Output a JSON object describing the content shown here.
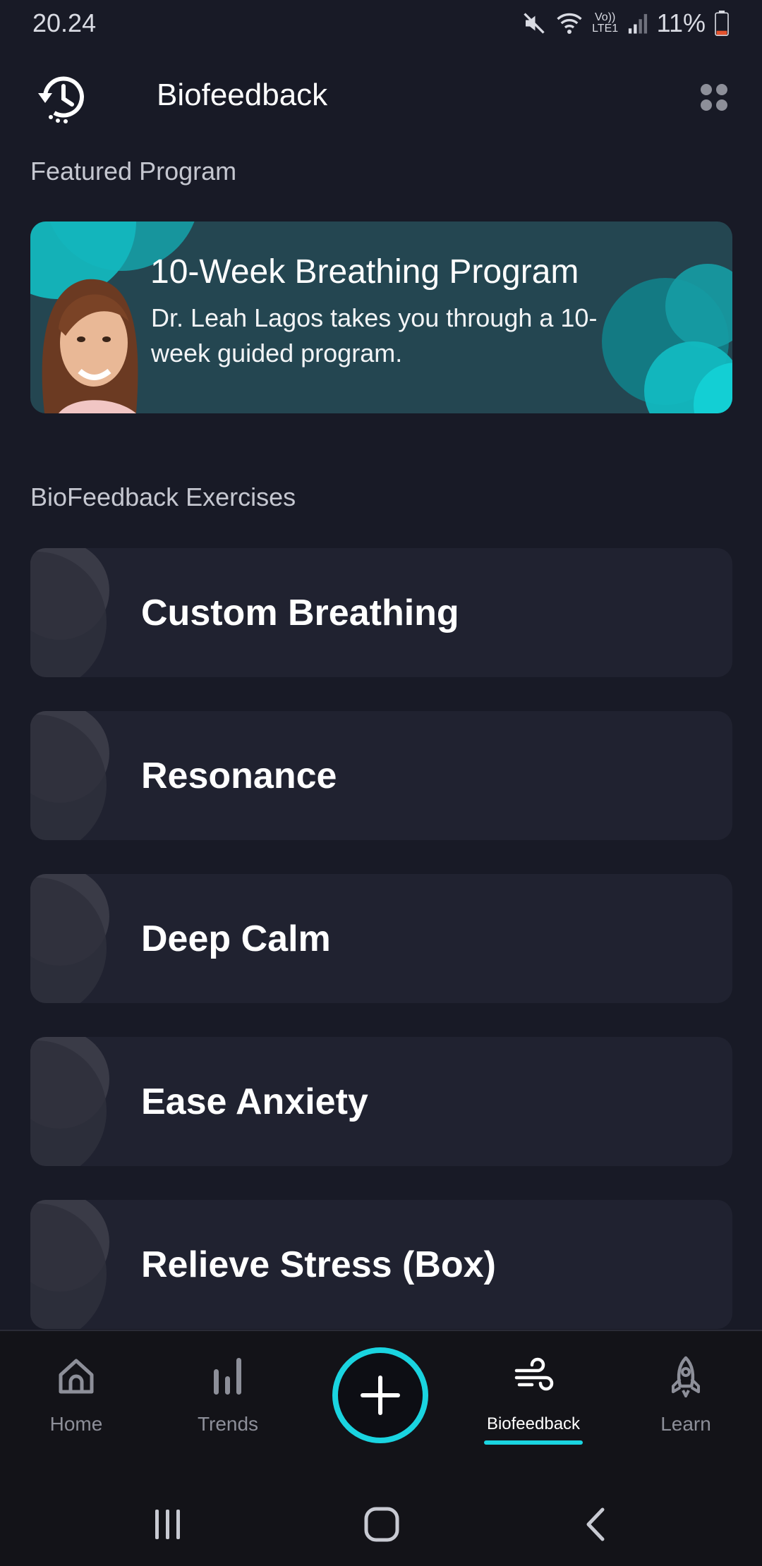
{
  "status_bar": {
    "time": "20.24",
    "battery": "11%",
    "network_label": "Vo)) LTE1"
  },
  "app_bar": {
    "title": "Biofeedback"
  },
  "featured": {
    "section_label": "Featured Program",
    "title": "10-Week Breathing Program",
    "description": "Dr. Leah Lagos takes you through a 10-week guided program."
  },
  "exercises": {
    "section_label": "BioFeedback Exercises",
    "items": [
      {
        "label": "Custom Breathing"
      },
      {
        "label": "Resonance"
      },
      {
        "label": "Deep Calm"
      },
      {
        "label": "Ease Anxiety"
      },
      {
        "label": "Relieve Stress (Box)"
      }
    ]
  },
  "bottom_nav": {
    "items": [
      {
        "label": "Home",
        "icon": "home-icon"
      },
      {
        "label": "Trends",
        "icon": "bar-chart-icon"
      },
      {
        "label": "Biofeedback",
        "icon": "wind-icon",
        "active": true
      },
      {
        "label": "Learn",
        "icon": "rocket-icon"
      }
    ],
    "fab_icon": "plus-icon"
  },
  "colors": {
    "accent": "#1ad4e0",
    "background": "#181a26",
    "card": "#202230",
    "featured_card": "#244651"
  }
}
